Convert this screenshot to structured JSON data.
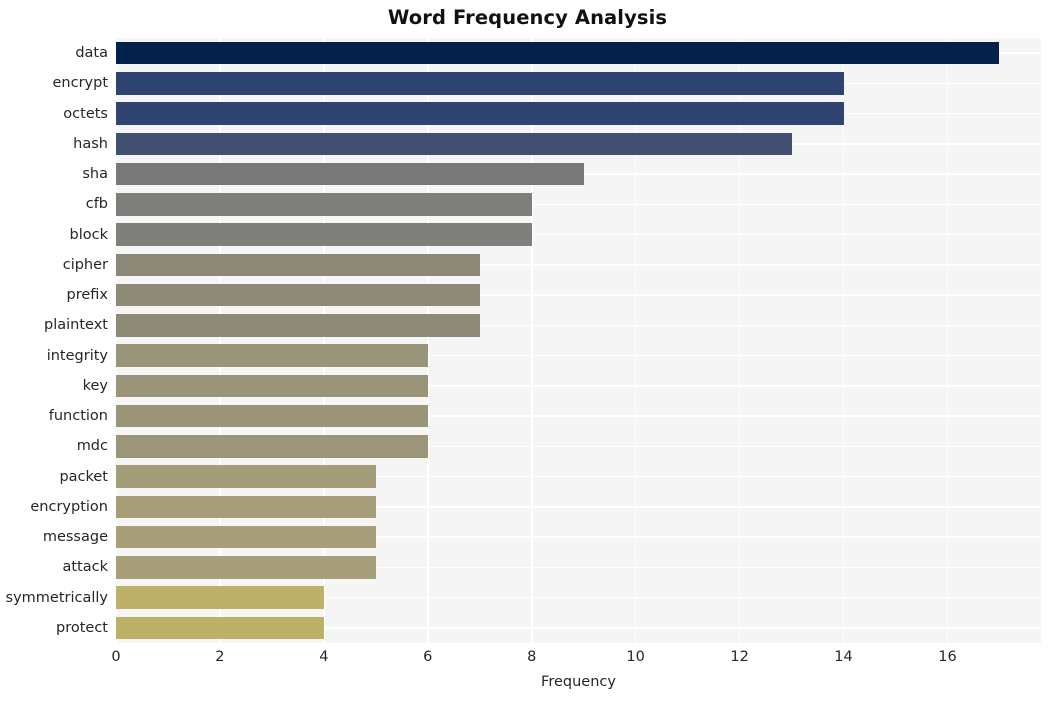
{
  "chart_data": {
    "type": "bar",
    "orientation": "horizontal",
    "title": "Word Frequency Analysis",
    "xlabel": "Frequency",
    "ylabel": "",
    "xlim": [
      0,
      17.8
    ],
    "ylim": [
      0,
      20
    ],
    "grid": true,
    "legend": null,
    "background": "#f5f5f5",
    "gridline_color": "#ffffff",
    "xticks": [
      0,
      2,
      4,
      6,
      8,
      10,
      12,
      14,
      16
    ],
    "xtick_labels": [
      "0",
      "2",
      "4",
      "6",
      "8",
      "10",
      "12",
      "14",
      "16"
    ],
    "categories": [
      "data",
      "encrypt",
      "octets",
      "hash",
      "sha",
      "cfb",
      "block",
      "cipher",
      "prefix",
      "plaintext",
      "integrity",
      "key",
      "function",
      "mdc",
      "packet",
      "encryption",
      "message",
      "attack",
      "symmetrically",
      "protect"
    ],
    "values": [
      17,
      14,
      14,
      13,
      9,
      8,
      8,
      7,
      7,
      7,
      6,
      6,
      6,
      6,
      5,
      5,
      5,
      5,
      4,
      4
    ],
    "bar_colors": [
      "#04214c",
      "#2e4370",
      "#2f4471",
      "#414f70",
      "#77787a",
      "#7e7e7b",
      "#7f7f7b",
      "#8b8878",
      "#8d8a78",
      "#8e8a78",
      "#99957a",
      "#9a9579",
      "#9a9579",
      "#9b9679",
      "#a49d7a",
      "#a59e79",
      "#a69f79",
      "#a79f79",
      "#bdb169",
      "#bdb168"
    ]
  }
}
